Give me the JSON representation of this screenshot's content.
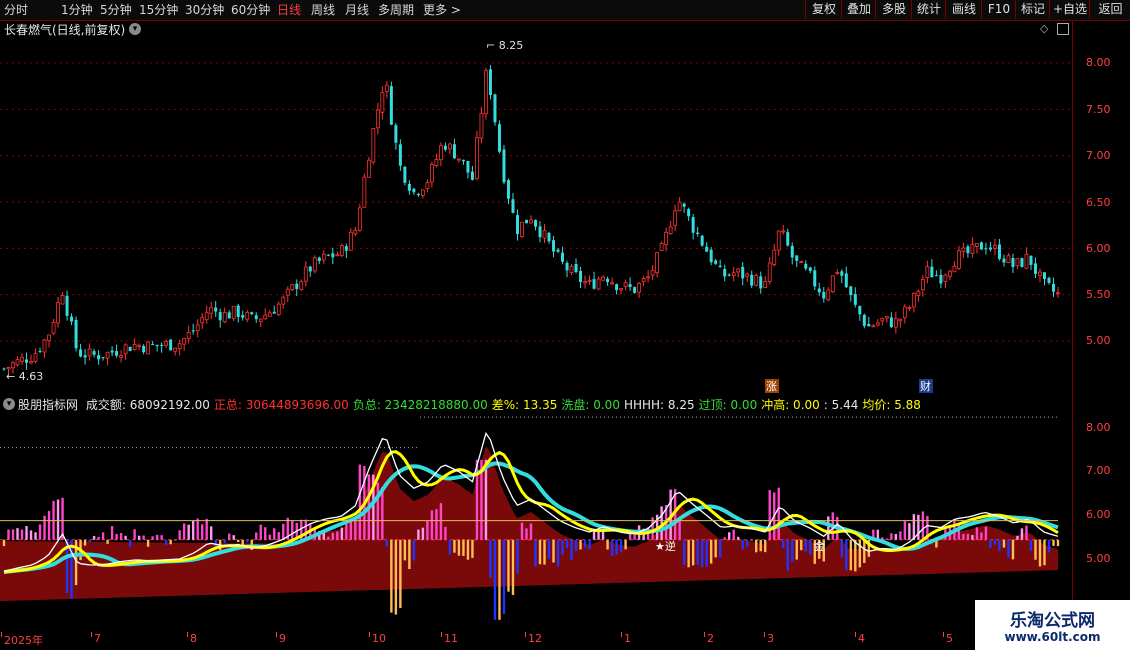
{
  "toolbar": {
    "periods": [
      "分时",
      "1分钟",
      "5分钟",
      "15分钟",
      "30分钟",
      "60分钟",
      "日线",
      "周线",
      "月线",
      "多周期",
      "更多 >"
    ],
    "active_period": "日线",
    "buttons": [
      "复权",
      "叠加",
      "多股",
      "统计",
      "画线",
      "F10",
      "标记",
      "+自选",
      "返回"
    ]
  },
  "stock": {
    "title": "长春燃气(日线,前复权)"
  },
  "main_chart": {
    "y_ticks": [
      "8.00",
      "7.50",
      "7.00",
      "6.50",
      "6.00",
      "5.50",
      "5.00"
    ],
    "high_label": "8.25",
    "low_label": "4.63",
    "event_tags": [
      "涨",
      "财"
    ]
  },
  "indicator": {
    "name": "股朋指标网",
    "fields": [
      {
        "label": "成交额:",
        "value": "68092192.00",
        "color": "#e6e6e6"
      },
      {
        "label": "正总:",
        "value": "30644893696.00",
        "color": "#ff3030"
      },
      {
        "label": "负总:",
        "value": "23428218880.00",
        "color": "#33dd33"
      },
      {
        "label": "差%:",
        "value": "13.35",
        "color": "#ffff00"
      },
      {
        "label": "洗盘:",
        "value": "0.00",
        "color": "#33dd33"
      },
      {
        "label": "HHHH:",
        "value": "8.25",
        "color": "#e6e6e6"
      },
      {
        "label": "过顶:",
        "value": "0.00",
        "color": "#33dd33"
      },
      {
        "label": "冲高:",
        "value": "0.00",
        "color": "#ffff00"
      },
      {
        "label": ":",
        "value": "5.44",
        "color": "#e6e6e6"
      },
      {
        "label": "均价:",
        "value": "5.88",
        "color": "#ffff00"
      }
    ],
    "y_ticks": [
      "8.00",
      "7.00",
      "6.00",
      "5.00"
    ],
    "marks": [
      "★逆",
      "金"
    ]
  },
  "time_axis": [
    "2025年",
    "7",
    "8",
    "9",
    "10",
    "11",
    "12",
    "1",
    "2",
    "3",
    "4",
    "5"
  ],
  "watermark": {
    "title": "乐淘公式网",
    "url": "www.60lt.com"
  },
  "colors": {
    "up": "#ff3333",
    "down": "#33dddd",
    "grid": "#8b0000",
    "axis": "#ff4040"
  },
  "chart_data": {
    "type": "candlestick",
    "close_series": [
      4.7,
      4.78,
      4.85,
      5.05,
      5.55,
      4.88,
      4.84,
      4.86,
      4.92,
      4.96,
      4.94,
      4.96,
      4.98,
      5.12,
      5.35,
      5.28,
      5.31,
      5.22,
      5.3,
      5.42,
      5.62,
      5.8,
      5.9,
      5.95,
      6.2,
      7.1,
      7.85,
      6.9,
      6.6,
      6.75,
      7.15,
      7.0,
      6.75,
      7.95,
      6.9,
      6.2,
      6.35,
      6.1,
      5.85,
      5.7,
      5.6,
      5.72,
      5.6,
      5.55,
      5.68,
      6.0,
      6.55,
      6.25,
      5.98,
      5.7,
      5.74,
      5.68,
      5.6,
      6.2,
      5.85,
      5.7,
      5.5,
      5.8,
      5.4,
      5.15,
      5.22,
      5.2,
      5.4,
      5.75,
      5.7,
      5.9,
      5.95,
      6.05,
      5.95,
      5.8,
      5.9,
      5.6,
      5.5
    ],
    "ylim": [
      4.55,
      8.35
    ]
  }
}
